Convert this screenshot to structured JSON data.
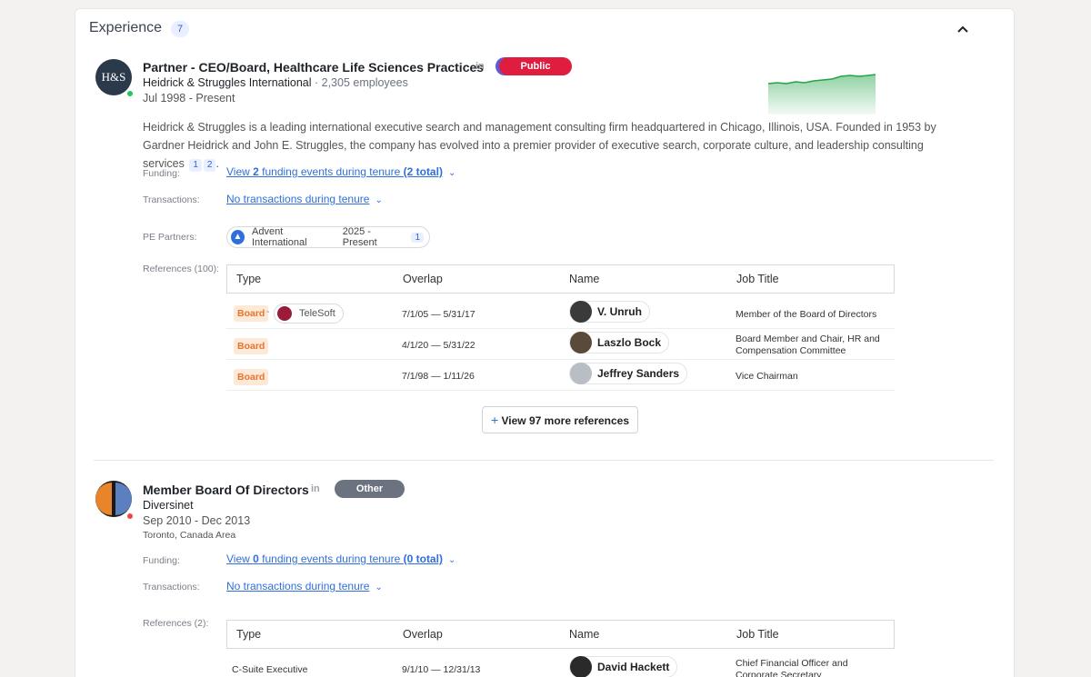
{
  "section": {
    "title": "Experience",
    "count": "7"
  },
  "experiences": [
    {
      "logo_text": "H&S",
      "role": "Partner - CEO/Board, Healthcare Life Sciences Practices",
      "linkedin": "in",
      "badge": "Public",
      "company": "Heidrick & Struggles International",
      "employees": " · 2,305 employees",
      "dates": "Jul 1998 - Present",
      "description": "Heidrick & Struggles is a leading international executive search and management consulting firm headquartered in Chicago, Illinois, USA. Founded in 1953 by Gardner Heidrick and John E. Struggles, the company has evolved into a premier provider of executive search, corporate culture, and leadership consulting services",
      "citations": [
        "1",
        "2"
      ],
      "funding_label": "Funding:",
      "funding_pre": "View ",
      "funding_count": "2",
      "funding_mid": " funding events during tenure ",
      "funding_total": "(2 total)",
      "transactions_label": "Transactions:",
      "transactions_text": "No transactions during tenure",
      "pe_label": "PE Partners:",
      "pe_partner": {
        "name": "Advent International",
        "dates": "2025 - Present",
        "count": "1"
      },
      "references_label": "References (100):",
      "table_headers": [
        "Type",
        "Overlap",
        "Name",
        "Job Title"
      ],
      "rows": [
        {
          "type": "Board",
          "company": "TeleSoft",
          "overlap": "7/1/05 — 5/31/17",
          "name": "V. Unruh",
          "title1": "Member of the Board of Directors",
          "title2": ""
        },
        {
          "type": "Board",
          "company": "",
          "overlap": "4/1/20 — 5/31/22",
          "name": "Laszlo Bock",
          "title1": "Board Member and Chair, HR and",
          "title2": "Compensation Committee"
        },
        {
          "type": "Board",
          "company": "",
          "overlap": "7/1/98 — 1/11/26",
          "name": "Jeffrey Sanders",
          "title1": "Vice Chairman",
          "title2": ""
        }
      ],
      "view_more": "View 97 more references"
    },
    {
      "role": "Member Board Of Directors",
      "linkedin": "in",
      "badge": "Other",
      "company": "Diversinet",
      "dates": "Sep 2010 - Dec 2013",
      "location": "Toronto, Canada Area",
      "funding_label": "Funding:",
      "funding_pre": "View ",
      "funding_count": "0",
      "funding_mid": " funding events during tenure ",
      "funding_total": "(0 total)",
      "transactions_label": "Transactions:",
      "transactions_text": "No transactions during tenure",
      "references_label": "References (2):",
      "table_headers": [
        "Type",
        "Overlap",
        "Name",
        "Job Title"
      ],
      "rows": [
        {
          "type": "C-Suite Executive",
          "overlap": "9/1/10 — 12/31/13",
          "name": "David Hackett",
          "title1": "Chief Financial Officer and",
          "title2": "Corporate Secretary"
        }
      ]
    }
  ],
  "colors": {
    "public": "#e11d3f",
    "other": "#6b7280",
    "link": "#2f6fdb",
    "sparkline": "#22a447"
  }
}
